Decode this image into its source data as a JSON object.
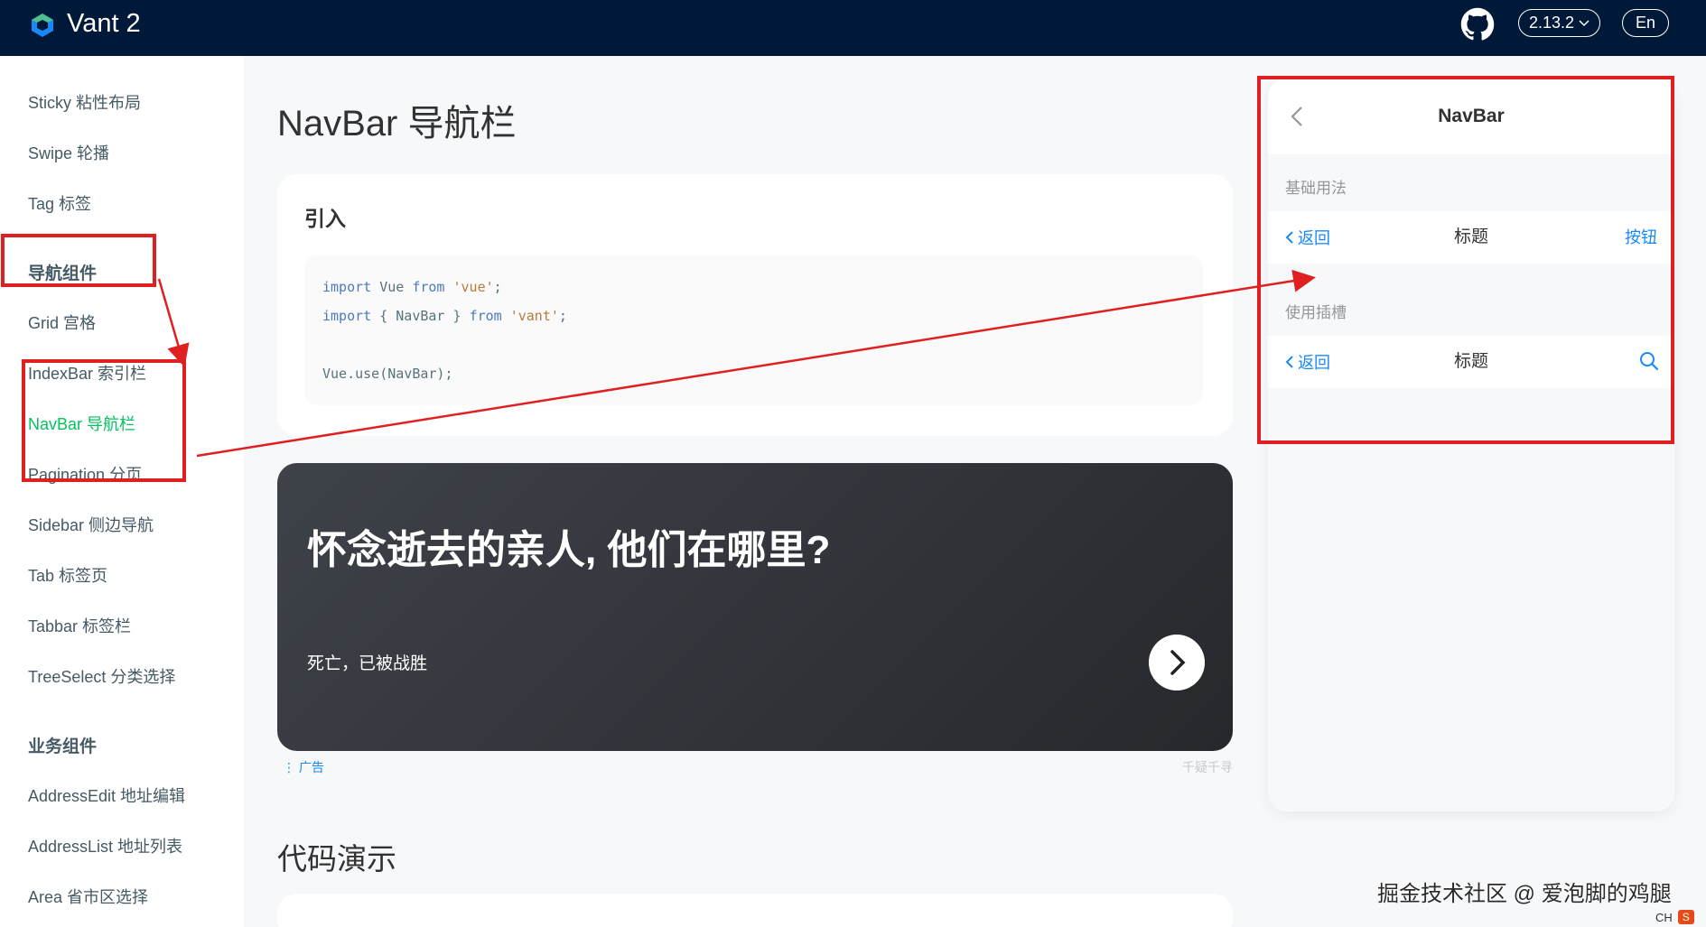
{
  "header": {
    "brand": "Vant 2",
    "version": "2.13.2",
    "lang": "En"
  },
  "sidebar": {
    "items_top": [
      "Sticky 粘性布局",
      "Swipe 轮播",
      "Tag 标签"
    ],
    "group_nav": "导航组件",
    "items_nav": [
      "Grid 宫格",
      "IndexBar 索引栏",
      "NavBar 导航栏",
      "Pagination 分页",
      "Sidebar 侧边导航",
      "Tab 标签页",
      "Tabbar 标签栏",
      "TreeSelect 分类选择"
    ],
    "active_item": "NavBar 导航栏",
    "group_biz": "业务组件",
    "items_biz": [
      "AddressEdit 地址编辑",
      "AddressList 地址列表",
      "Area 省市区选择"
    ]
  },
  "main": {
    "page_title": "NavBar 导航栏",
    "intro_title": "引入",
    "code": {
      "line1": [
        "import",
        "Vue",
        "from",
        "'vue'",
        ";"
      ],
      "line2": [
        "import",
        "{ NavBar }",
        "from",
        "'vant'",
        ";"
      ],
      "line3": "Vue.use(NavBar);"
    },
    "ad": {
      "title": "怀念逝去的亲人, 他们在哪里?",
      "subtitle": "死亡，已被战胜",
      "tag": "广告",
      "source": "千疑千寻"
    },
    "demo_section_title": "代码演示"
  },
  "phone": {
    "nav_title": "NavBar",
    "demo1": {
      "label": "基础用法",
      "left": "返回",
      "title": "标题",
      "right": "按钮"
    },
    "demo2": {
      "label": "使用插槽",
      "left": "返回",
      "title": "标题"
    }
  },
  "overlay": {
    "watermark": "掘金技术社区 @ 爱泡脚的鸡腿",
    "ime_lang": "CH",
    "ime_icon": "S",
    "annotation_color": "#e02020"
  },
  "colors": {
    "header_bg": "#001938",
    "active": "#07c160",
    "link": "#1989fa"
  },
  "icons": [
    "vant-logo-icon",
    "github-icon",
    "chevron-down-icon",
    "chevron-left-icon",
    "chevron-right-icon",
    "search-icon"
  ]
}
